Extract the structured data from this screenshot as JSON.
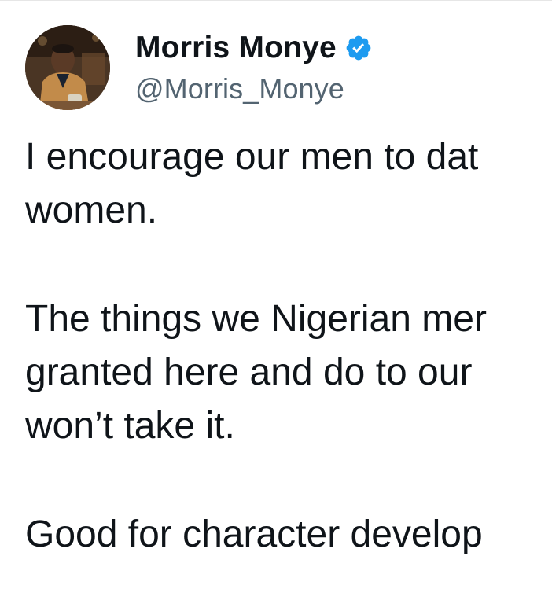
{
  "author": {
    "display_name": "Morris Monye",
    "handle": "@Morris_Monye",
    "verified_icon": "verified-badge-icon",
    "avatar": "profile-photo"
  },
  "tweet": {
    "paragraph1": {
      "line1": "I encourage our men to dat",
      "line2": "women."
    },
    "paragraph2": {
      "line1": "The things we Nigerian mer",
      "line2": "granted here and do to our",
      "line3": "won’t take it."
    },
    "paragraph3": {
      "line1": "Good for character develop"
    }
  },
  "colors": {
    "text": "#0f1419",
    "secondary": "#536471",
    "verified": "#1d9bf0"
  }
}
